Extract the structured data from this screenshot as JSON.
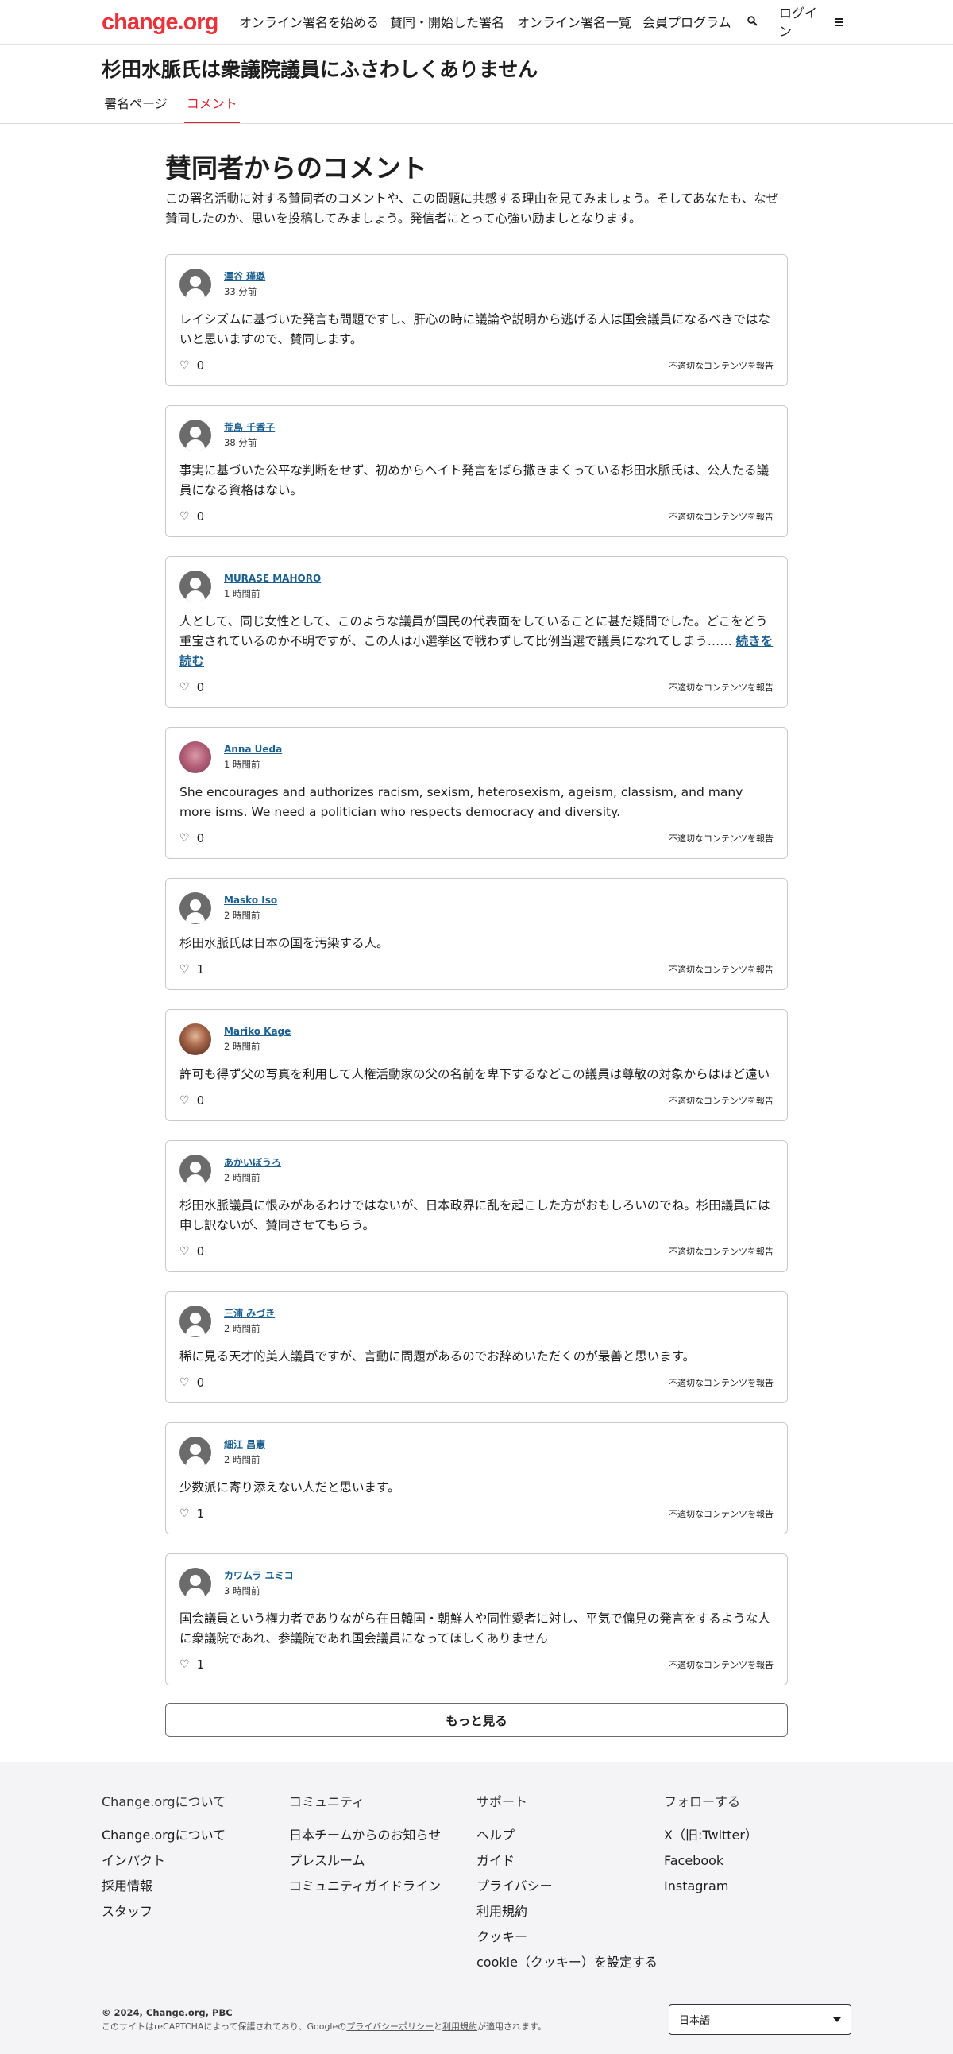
{
  "header": {
    "logo": "change.org",
    "nav": [
      "オンライン署名を始める",
      "賛同・開始した署名",
      "オンライン署名一覧",
      "会員プログラム"
    ],
    "search_icon": "search-icon",
    "login": "ログイン",
    "menu_icon": "hamburger-icon"
  },
  "petition": {
    "title": "杉田水脈氏は衆議院議員にふさわしくありません",
    "tabs": [
      "署名ページ",
      "コメント"
    ],
    "active_tab": "コメント"
  },
  "main": {
    "heading": "賛同者からのコメント",
    "intro": "この署名活動に対する賛同者のコメントや、この問題に共感する理由を見てみましょう。そしてあなたも、なぜ賛同したのか、思いを投稿してみましょう。発信者にとって心強い励ましとなります。",
    "report_label": "不適切なコンテンツを報告",
    "read_more": "続きを読む",
    "more_button": "もっと見る"
  },
  "comments": [
    {
      "author": "澤谷 瑾璐",
      "time": "33 分前",
      "text": "レイシズムに基づいた発言も問題ですし、肝心の時に議論や説明から逃げる人は国会議員になるべきではないと思いますので、賛同します。",
      "likes": "0",
      "avatar": "default"
    },
    {
      "author": "荒島 千香子",
      "time": "38 分前",
      "text": "事実に基づいた公平な判断をせず、初めからヘイト発言をばら撒きまくっている杉田水脈氏は、公人たる議員になる資格はない。",
      "likes": "0",
      "avatar": "default"
    },
    {
      "author": "MURASE MAHORO",
      "time": "1 時間前",
      "text": "人として、同じ女性として、このような議員が国民の代表面をしていることに甚だ疑問でした。どこをどう重宝されているのか不明ですが、この人は小選挙区で戦わずして比例当選で議員になれてしまう…… ",
      "likes": "0",
      "avatar": "default",
      "truncated": true
    },
    {
      "author": "Anna Ueda",
      "time": "1 時間前",
      "text": "She encourages and authorizes racism, sexism, heterosexism, ageism, classism, and many more isms. We need a politician who respects democracy and diversity.",
      "likes": "0",
      "avatar": "photo1"
    },
    {
      "author": "Masko Iso",
      "time": "2 時間前",
      "text": "杉田水脈氏は日本の国を汚染する人。",
      "likes": "1",
      "avatar": "default"
    },
    {
      "author": "Mariko Kage",
      "time": "2 時間前",
      "text": "許可も得ず父の写真を利用して人権活動家の父の名前を卑下するなどこの議員は尊敬の対象からはほど遠い",
      "likes": "0",
      "avatar": "photo2"
    },
    {
      "author": "あかいぼうろ",
      "time": "2 時間前",
      "text": "杉田水脈議員に恨みがあるわけではないが、日本政界に乱を起こした方がおもしろいのでね。杉田議員には申し訳ないが、賛同させてもらう。",
      "likes": "0",
      "avatar": "default"
    },
    {
      "author": "三浦 みづき",
      "time": "2 時間前",
      "text": "稀に見る天才的美人議員ですが、言動に問題があるのでお辞めいただくのが最善と思います。",
      "likes": "0",
      "avatar": "default"
    },
    {
      "author": "細江 昌憲",
      "time": "2 時間前",
      "text": "少数派に寄り添えない人だと思います。",
      "likes": "1",
      "avatar": "default"
    },
    {
      "author": "カワムラ ユミコ",
      "time": "3 時間前",
      "text": "国会議員という権力者でありながら在日韓国・朝鮮人や同性愛者に対し、平気で偏見の発言をするような人に衆議院であれ、参議院であれ国会議員になってほしくありません",
      "likes": "1",
      "avatar": "default"
    }
  ],
  "footer": {
    "columns": [
      {
        "title": "Change.orgについて",
        "links": [
          "Change.orgについて",
          "インパクト",
          "採用情報",
          "スタッフ"
        ]
      },
      {
        "title": "コミュニティ",
        "links": [
          "日本チームからのお知らせ",
          "プレスルーム",
          "コミュニティガイドライン"
        ]
      },
      {
        "title": "サポート",
        "links": [
          "ヘルプ",
          "ガイド",
          "プライバシー",
          "利用規約",
          "クッキー",
          "cookie（クッキー）を設定する"
        ]
      },
      {
        "title": "フォローする",
        "links": [
          "X（旧:Twitter）",
          "Facebook",
          "Instagram"
        ]
      }
    ],
    "copyright": "© 2024, Change.org, PBC",
    "recaptcha_pre": "このサイトはreCAPTCHAによって保護されており、Googleの",
    "privacy_link": "プライバシーポリシー",
    "recaptcha_mid": "と",
    "terms_link": "利用規約",
    "recaptcha_post": "が適用されます。",
    "language": "日本語"
  }
}
